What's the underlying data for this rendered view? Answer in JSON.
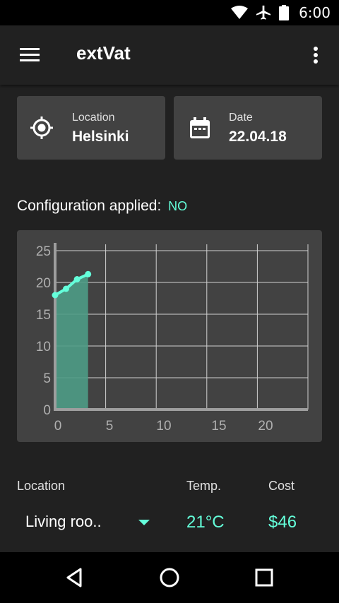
{
  "status_bar": {
    "time": "6:00",
    "icons": [
      "wifi-icon",
      "airplane-icon",
      "battery-icon"
    ]
  },
  "app_bar": {
    "title": "extVat",
    "menu_icon": "hamburger-icon",
    "more_icon": "more-vert-icon"
  },
  "location_card": {
    "label": "Location",
    "value": "Helsinki",
    "icon": "location-crosshair-icon"
  },
  "date_card": {
    "label": "Date",
    "value": "22.04.18",
    "icon": "calendar-icon"
  },
  "config": {
    "label": "Configuration applied:",
    "status": "NO"
  },
  "colors": {
    "accent": "#64ffda",
    "card": "#424242",
    "background": "#212121",
    "area_fill": "#4e9c86"
  },
  "chart_data": {
    "type": "area",
    "x": [
      0,
      1,
      2,
      3
    ],
    "y": [
      18,
      19,
      20.5,
      21.3
    ],
    "xticks": [
      "0",
      "5",
      "10",
      "15",
      "20"
    ],
    "yticks": [
      "0",
      "5",
      "10",
      "15",
      "20",
      "25"
    ],
    "xlim": [
      0,
      23
    ],
    "ylim": [
      0,
      26
    ],
    "grid": true
  },
  "table": {
    "headers": {
      "location": "Location",
      "temp": "Temp.",
      "cost": "Cost"
    },
    "row": {
      "location": "Living roo..",
      "temp": "21°C",
      "cost": "$46"
    }
  },
  "nav_bar": {
    "icons": [
      "back-icon",
      "home-icon",
      "recents-icon"
    ]
  }
}
